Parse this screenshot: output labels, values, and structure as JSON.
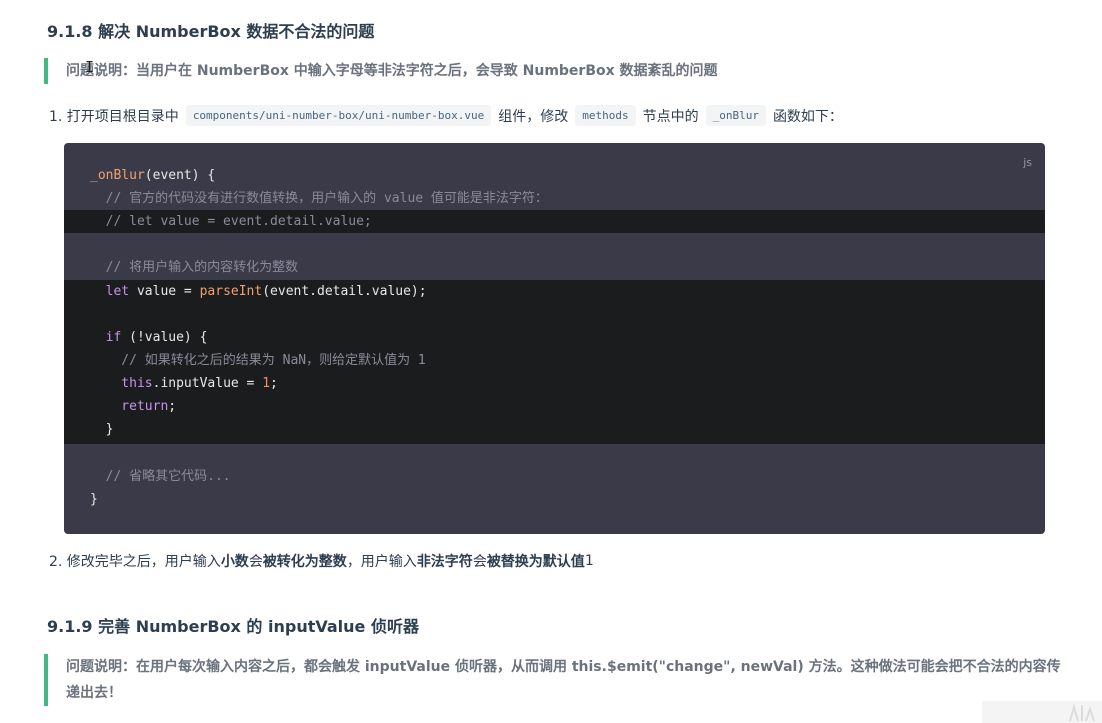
{
  "section1": {
    "heading": "9.1.8 解决 NumberBox 数据不合法的问题",
    "callout": "问题说明：当用户在 NumberBox 中输入字母等非法字符之后，会导致 NumberBox 数据紊乱的问题"
  },
  "step1": {
    "prefix": "1. 打开项目根目录中",
    "path": "components/uni-number-box/uni-number-box.vue",
    "middle": "组件，修改",
    "methods": "methods",
    "after_methods": "节点中的",
    "onblur": "_onBlur",
    "suffix": "函数如下："
  },
  "code": {
    "lang": "js",
    "l1_fn": "_onBlur",
    "l1_rest": "(event) {",
    "l2": "  // 官方的代码没有进行数值转换，用户输入的 value 值可能是非法字符：",
    "l3": "  // let value = event.detail.value;",
    "l5": "  // 将用户输入的内容转化为整数",
    "l6_kw": "  let",
    "l6_a": " value = ",
    "l6_fn": "parseInt",
    "l6_b": "(event.detail.value);",
    "l8_kw": "  if",
    "l8_rest": " (!value) {",
    "l9": "    // 如果转化之后的结果为 NaN，则给定默认值为 1",
    "l10_kw": "    this",
    "l10_a": ".inputValue = ",
    "l10_num": "1",
    "l10_b": ";",
    "l11_kw": "    return",
    "l11_b": ";",
    "l12": "  }",
    "l14": "  // 省略其它代码...",
    "l15": "}"
  },
  "step2": {
    "p1": "2. 修改完毕之后，用户输入",
    "b1": "小数",
    "p2": "会",
    "b2": "被转化为整数",
    "p3": "，用户输入",
    "b3": "非法字符",
    "p4": "会",
    "b4": "被替换为默认值",
    "p5": " 1"
  },
  "section2": {
    "heading": "9.1.9 完善 NumberBox 的 inputValue 侦听器",
    "callout": "问题说明：在用户每次输入内容之后，都会触发 inputValue 侦听器，从而调用 this.$emit(\"change\", newVal) 方法。这种做法可能会把不合法的内容传递出去！"
  },
  "cursor": "I"
}
